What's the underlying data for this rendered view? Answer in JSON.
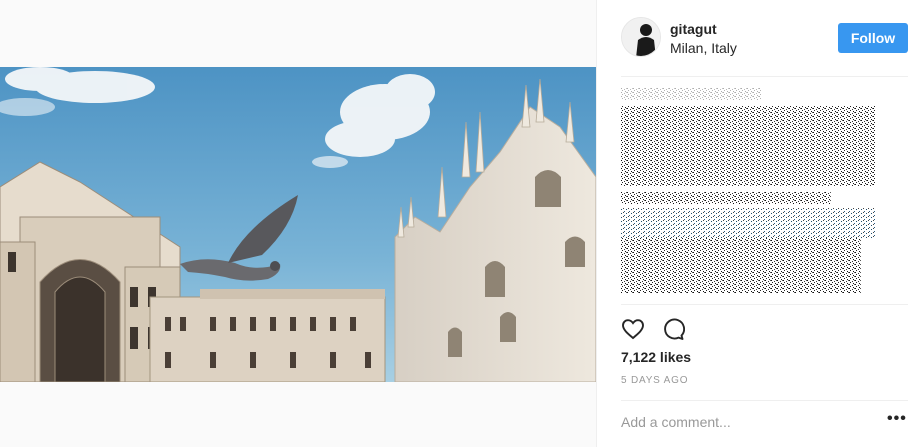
{
  "post": {
    "username": "gitagut",
    "location": "Milan, Italy",
    "follow_label": "Follow",
    "likes": "7,122 likes",
    "time_ago": "5 DAYS AGO",
    "comment_placeholder": "Add a comment...",
    "more_label": "•••"
  },
  "icons": {
    "like": "heart-icon",
    "comment": "speech-bubble-icon",
    "more": "more-options-icon"
  },
  "colors": {
    "follow_button": "#3897f0",
    "sky": "#6ea9cf",
    "text_primary": "#262626",
    "text_secondary": "#999999"
  }
}
